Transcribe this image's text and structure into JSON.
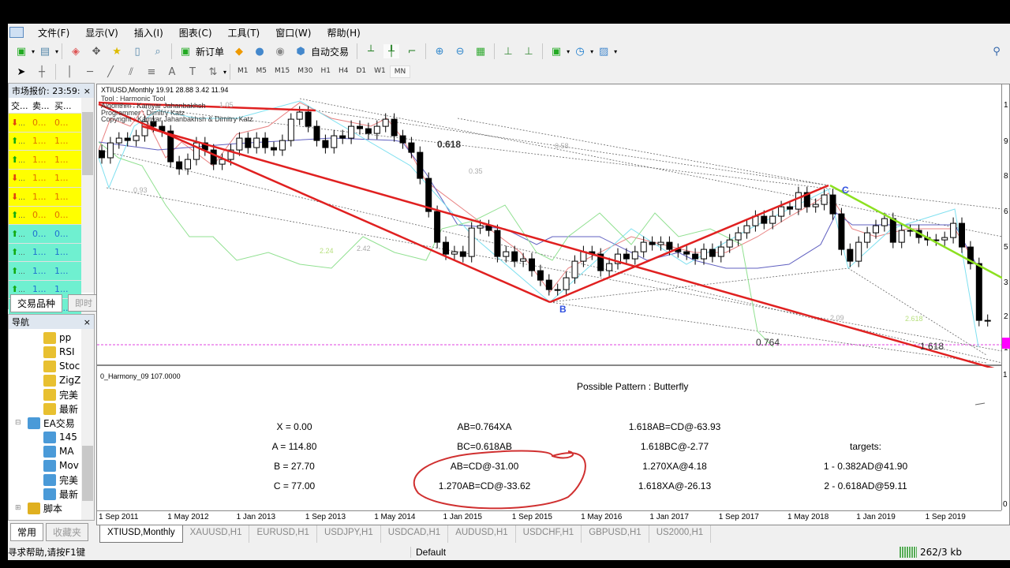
{
  "menu": [
    "文件(F)",
    "显示(V)",
    "插入(I)",
    "图表(C)",
    "工具(T)",
    "窗口(W)",
    "帮助(H)"
  ],
  "toolbar": {
    "new_order": "新订单",
    "auto_trading": "自动交易"
  },
  "timeframes": [
    "M1",
    "M5",
    "M15",
    "M30",
    "H1",
    "H4",
    "D1",
    "W1",
    "MN"
  ],
  "selected_timeframe": "MN",
  "market_watch": {
    "title": "市场报价: 23:59:",
    "columns": [
      "交...",
      "卖...",
      "买..."
    ],
    "rows": [
      {
        "dir": "down",
        "sym": "...",
        "bid": "0...",
        "ask": "0...",
        "bg": "#ffff00",
        "fg": "#e07000"
      },
      {
        "dir": "up",
        "sym": "...",
        "bid": "1...",
        "ask": "1...",
        "bg": "#ffff00",
        "fg": "#e07000"
      },
      {
        "dir": "up",
        "sym": "...",
        "bid": "1...",
        "ask": "1...",
        "bg": "#ffff00",
        "fg": "#e07000"
      },
      {
        "dir": "down",
        "sym": "...",
        "bid": "1...",
        "ask": "1...",
        "bg": "#ffff00",
        "fg": "#e07000"
      },
      {
        "dir": "down",
        "sym": "...",
        "bid": "1...",
        "ask": "1...",
        "bg": "#ffff00",
        "fg": "#e07000"
      },
      {
        "dir": "up",
        "sym": "...",
        "bid": "0...",
        "ask": "0...",
        "bg": "#ffff00",
        "fg": "#e07000"
      },
      {
        "dir": "up",
        "sym": "...",
        "bid": "0...",
        "ask": "0...",
        "bg": "#6ff0d0",
        "fg": "#1e6fd0"
      },
      {
        "dir": "up",
        "sym": "...",
        "bid": "1...",
        "ask": "1...",
        "bg": "#6ff0d0",
        "fg": "#1e6fd0"
      },
      {
        "dir": "up",
        "sym": "...",
        "bid": "1...",
        "ask": "1...",
        "bg": "#6ff0d0",
        "fg": "#1e6fd0"
      },
      {
        "dir": "up",
        "sym": "...",
        "bid": "1...",
        "ask": "1...",
        "bg": "#6ff0d0",
        "fg": "#1e6fd0"
      },
      {
        "dir": "up",
        "sym": "...",
        "bid": "1...",
        "ask": "1...",
        "bg": "#6ff0d0",
        "fg": "#1e6fd0"
      },
      {
        "dir": "down",
        "sym": "...",
        "bid": "1...",
        "ask": "1...",
        "bg": "#6ff0d0",
        "fg": "#c08000"
      }
    ],
    "tabs": [
      "交易品种",
      "即时"
    ]
  },
  "navigator": {
    "title": "导航",
    "items": [
      {
        "label": "pp",
        "type": "indicator",
        "indent": 2
      },
      {
        "label": "RSI",
        "type": "indicator",
        "indent": 2
      },
      {
        "label": "Stoc",
        "type": "indicator",
        "indent": 2
      },
      {
        "label": "ZigZ",
        "type": "indicator",
        "indent": 2
      },
      {
        "label": "完美",
        "type": "indicator",
        "indent": 2
      },
      {
        "label": "最新",
        "type": "indicator",
        "indent": 2
      },
      {
        "label": "EA交易",
        "type": "ea",
        "indent": 1
      },
      {
        "label": "145",
        "type": "ea",
        "indent": 2
      },
      {
        "label": "MA",
        "type": "ea",
        "indent": 2
      },
      {
        "label": "Mov",
        "type": "ea",
        "indent": 2
      },
      {
        "label": "完美",
        "type": "ea",
        "indent": 2
      },
      {
        "label": "最新",
        "type": "ea",
        "indent": 2
      },
      {
        "label": "脚本",
        "type": "script",
        "indent": 1
      }
    ],
    "tabs": [
      "常用",
      "收藏夹"
    ]
  },
  "chart": {
    "header": "XTIUSD,Monthly  19.91 28.88 3.42 11.94",
    "info": [
      "Tool        : Harmonic Tool",
      "Algorithm    : Kamyar Jahanbakhsh",
      "Programmer : Dimitry Katz",
      "Copyright   : Kamyar Jahanbakhsh & Dimitry Katz"
    ],
    "fib_labels": {
      "f0618": "0.618",
      "f0764": "0.764",
      "f1618": "1.618",
      "f105": "1.05",
      "f093": "0.93",
      "f058": "0.58",
      "f035": "0.35",
      "f242": "2.42",
      "f209": "2.09",
      "f2618": "2.618",
      "f224": "2.24"
    },
    "point_labels": {
      "B": "B",
      "C": "C"
    },
    "price_axis_visible": [
      "1",
      "9",
      "8",
      "6",
      "5",
      "3",
      "2",
      "1"
    ],
    "lower_axis_visible": [
      "1",
      "0"
    ],
    "time_axis": [
      "1 Sep 2011",
      "1 May 2012",
      "1 Jan 2013",
      "1 Sep 2013",
      "1 May 2014",
      "1 Jan 2015",
      "1 Sep 2015",
      "1 May 2016",
      "1 Jan 2017",
      "1 Sep 2017",
      "1 May 2018",
      "1 Jan 2019",
      "1 Sep 2019"
    ],
    "colors": {
      "pattern": "#e02020",
      "trend": "#8ce020",
      "ma_red": "#e88080",
      "ma_blue": "#6060c0",
      "ma_cyan": "#7fe0f0",
      "osc_green": "#90e090"
    }
  },
  "chart_data": {
    "type": "candlestick",
    "series": "XTIUSD Monthly",
    "close": [
      [
        "2011-09",
        88.7
      ],
      [
        "2011-10",
        95
      ],
      [
        "2011-11",
        97
      ],
      [
        "2011-12",
        96
      ],
      [
        "2012-01",
        98
      ],
      [
        "2012-02",
        104
      ],
      [
        "2012-03",
        102
      ],
      [
        "2012-04",
        100
      ],
      [
        "2012-05",
        87
      ],
      [
        "2012-06",
        84
      ],
      [
        "2012-07",
        88
      ],
      [
        "2012-08",
        95
      ],
      [
        "2012-09",
        92
      ],
      [
        "2012-10",
        86
      ],
      [
        "2012-11",
        88
      ],
      [
        "2012-12",
        92
      ],
      [
        "2013-01",
        97
      ],
      [
        "2013-02",
        93
      ],
      [
        "2013-03",
        97
      ],
      [
        "2013-04",
        93
      ],
      [
        "2013-05",
        92
      ],
      [
        "2013-06",
        96
      ],
      [
        "2013-07",
        105
      ],
      [
        "2013-08",
        108
      ],
      [
        "2013-09",
        102
      ],
      [
        "2013-10",
        96
      ],
      [
        "2013-11",
        93
      ],
      [
        "2013-12",
        98
      ],
      [
        "2014-01",
        97
      ],
      [
        "2014-02",
        102
      ],
      [
        "2014-03",
        101
      ],
      [
        "2014-04",
        99
      ],
      [
        "2014-05",
        102
      ],
      [
        "2014-06",
        105
      ],
      [
        "2014-07",
        98
      ],
      [
        "2014-08",
        95
      ],
      [
        "2014-09",
        91
      ],
      [
        "2014-10",
        80
      ],
      [
        "2014-11",
        66
      ],
      [
        "2014-12",
        53
      ],
      [
        "2015-01",
        48
      ],
      [
        "2015-02",
        49
      ],
      [
        "2015-03",
        47
      ],
      [
        "2015-04",
        59
      ],
      [
        "2015-05",
        60
      ],
      [
        "2015-06",
        58
      ],
      [
        "2015-07",
        47
      ],
      [
        "2015-08",
        49
      ],
      [
        "2015-09",
        45
      ],
      [
        "2015-10",
        46
      ],
      [
        "2015-11",
        41
      ],
      [
        "2015-12",
        37
      ],
      [
        "2016-01",
        33
      ],
      [
        "2016-02",
        33
      ],
      [
        "2016-03",
        38
      ],
      [
        "2016-04",
        45
      ],
      [
        "2016-05",
        49
      ],
      [
        "2016-06",
        48
      ],
      [
        "2016-07",
        41
      ],
      [
        "2016-08",
        44
      ],
      [
        "2016-09",
        48
      ],
      [
        "2016-10",
        46
      ],
      [
        "2016-11",
        49
      ],
      [
        "2016-12",
        53
      ],
      [
        "2017-01",
        52
      ],
      [
        "2017-02",
        53
      ],
      [
        "2017-03",
        50
      ],
      [
        "2017-04",
        49
      ],
      [
        "2017-05",
        48
      ],
      [
        "2017-06",
        46
      ],
      [
        "2017-07",
        50
      ],
      [
        "2017-08",
        47
      ],
      [
        "2017-09",
        51
      ],
      [
        "2017-10",
        54
      ],
      [
        "2017-11",
        57
      ],
      [
        "2017-12",
        60
      ],
      [
        "2018-01",
        64
      ],
      [
        "2018-02",
        61
      ],
      [
        "2018-03",
        64
      ],
      [
        "2018-04",
        68
      ],
      [
        "2018-05",
        67
      ],
      [
        "2018-06",
        74
      ],
      [
        "2018-07",
        68
      ],
      [
        "2018-08",
        69
      ],
      [
        "2018-09",
        73
      ],
      [
        "2018-10",
        65
      ],
      [
        "2018-11",
        50
      ],
      [
        "2018-12",
        45
      ],
      [
        "2019-01",
        53
      ],
      [
        "2019-02",
        57
      ],
      [
        "2019-03",
        60
      ],
      [
        "2019-04",
        63
      ],
      [
        "2019-05",
        53
      ],
      [
        "2019-06",
        58
      ],
      [
        "2019-07",
        58
      ],
      [
        "2019-08",
        55
      ],
      [
        "2019-09",
        54
      ],
      [
        "2019-10",
        54
      ],
      [
        "2019-11",
        55
      ],
      [
        "2019-12",
        61
      ],
      [
        "2020-01",
        51
      ],
      [
        "2020-02",
        44
      ],
      [
        "2020-03",
        20
      ],
      [
        "2020-04",
        19.91
      ]
    ],
    "pattern_points": {
      "A": 114.8,
      "B": 27.7,
      "C": 77.0
    }
  },
  "harmony": {
    "indicator": "0_Harmony_09 107.0000",
    "title": "Possible Pattern : Butterfly",
    "col1": [
      "X = 0.00",
      "A = 114.80",
      "B = 27.70",
      "C = 77.00"
    ],
    "col2": [
      "AB=0.764XA",
      "BC=0.618AB",
      "AB=CD@-31.00",
      "1.270AB=CD@-33.62"
    ],
    "col3": [
      "1.618AB=CD@-63.93",
      "1.618BC@-2.77",
      "1.270XA@4.18",
      "1.618XA@-26.13"
    ],
    "col4": [
      "",
      "targets:",
      "1 - 0.382AD@41.90",
      "2 - 0.618AD@59.11"
    ]
  },
  "chart_tabs": [
    "XTIUSD,Monthly",
    "XAUUSD,H1",
    "EURUSD,H1",
    "USDJPY,H1",
    "USDCAD,H1",
    "AUDUSD,H1",
    "USDCHF,H1",
    "GBPUSD,H1",
    "US2000,H1"
  ],
  "status": {
    "help": "寻求帮助,请按F1键",
    "profile": "Default",
    "traffic": "262/3 kb"
  }
}
